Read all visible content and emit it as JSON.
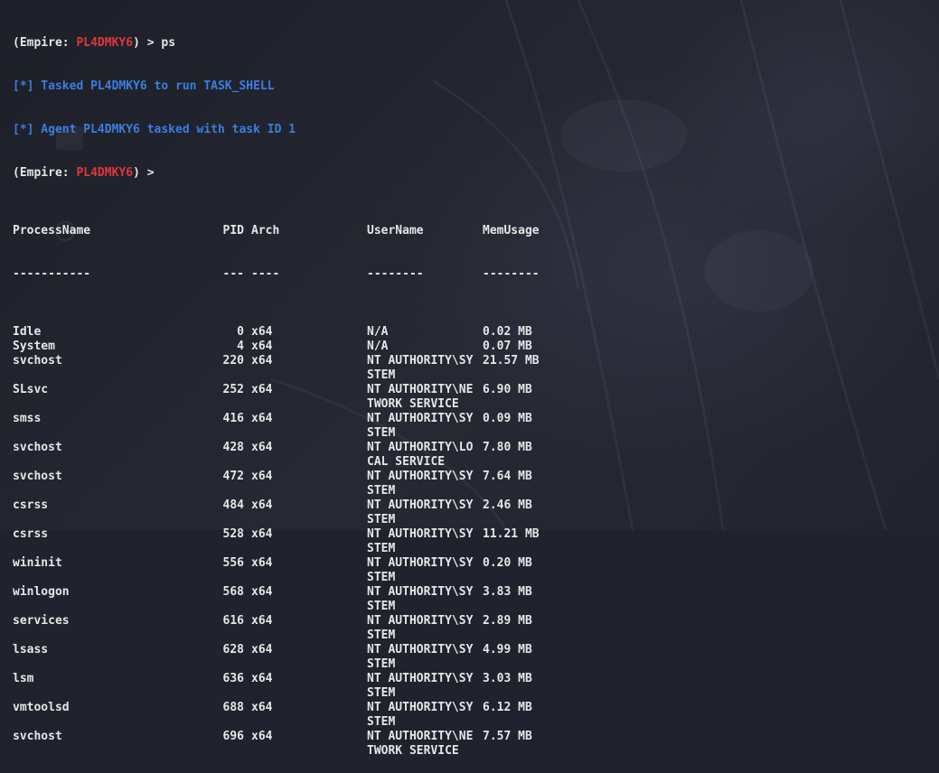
{
  "prompt": {
    "prefix": "(Empire: ",
    "agent": "PL4DMKY6",
    "suffix": ") > ",
    "command": "ps"
  },
  "messages": [
    "[*] Tasked PL4DMKY6 to run TASK_SHELL",
    "[*] Agent PL4DMKY6 tasked with task ID 1"
  ],
  "prompt2": {
    "prefix": "(Empire: ",
    "agent": "PL4DMKY6",
    "suffix": ") >"
  },
  "table": {
    "headers": [
      "ProcessName",
      "PID",
      "Arch",
      "UserName",
      "MemUsage"
    ],
    "separators": [
      "-----------",
      "---",
      "----",
      "--------",
      "--------"
    ],
    "rows": [
      {
        "name": "Idle",
        "pid": "0",
        "arch": "x64",
        "user": "N/A",
        "user2": "",
        "mem": "0.02 MB"
      },
      {
        "name": "System",
        "pid": "4",
        "arch": "x64",
        "user": "N/A",
        "user2": "",
        "mem": "0.07 MB"
      },
      {
        "name": "svchost",
        "pid": "220",
        "arch": "x64",
        "user": "NT AUTHORITY\\SY",
        "user2": "STEM",
        "mem": "21.57 MB"
      },
      {
        "name": "SLsvc",
        "pid": "252",
        "arch": "x64",
        "user": "NT AUTHORITY\\NE",
        "user2": "TWORK SERVICE",
        "mem": "6.90 MB"
      },
      {
        "name": "smss",
        "pid": "416",
        "arch": "x64",
        "user": "NT AUTHORITY\\SY",
        "user2": "STEM",
        "mem": "0.09 MB"
      },
      {
        "name": "svchost",
        "pid": "428",
        "arch": "x64",
        "user": "NT AUTHORITY\\LO",
        "user2": "CAL SERVICE",
        "mem": "7.80 MB"
      },
      {
        "name": "svchost",
        "pid": "472",
        "arch": "x64",
        "user": "NT AUTHORITY\\SY",
        "user2": "STEM",
        "mem": "7.64 MB"
      },
      {
        "name": "csrss",
        "pid": "484",
        "arch": "x64",
        "user": "NT AUTHORITY\\SY",
        "user2": "STEM",
        "mem": "2.46 MB"
      },
      {
        "name": "csrss",
        "pid": "528",
        "arch": "x64",
        "user": "NT AUTHORITY\\SY",
        "user2": "STEM",
        "mem": "11.21 MB"
      },
      {
        "name": "wininit",
        "pid": "556",
        "arch": "x64",
        "user": "NT AUTHORITY\\SY",
        "user2": "STEM",
        "mem": "0.20 MB"
      },
      {
        "name": "winlogon",
        "pid": "568",
        "arch": "x64",
        "user": "NT AUTHORITY\\SY",
        "user2": "STEM",
        "mem": "3.83 MB"
      },
      {
        "name": "services",
        "pid": "616",
        "arch": "x64",
        "user": "NT AUTHORITY\\SY",
        "user2": "STEM",
        "mem": "2.89 MB"
      },
      {
        "name": "lsass",
        "pid": "628",
        "arch": "x64",
        "user": "NT AUTHORITY\\SY",
        "user2": "STEM",
        "mem": "4.99 MB"
      },
      {
        "name": "lsm",
        "pid": "636",
        "arch": "x64",
        "user": "NT AUTHORITY\\SY",
        "user2": "STEM",
        "mem": "3.03 MB"
      },
      {
        "name": "vmtoolsd",
        "pid": "688",
        "arch": "x64",
        "user": "NT AUTHORITY\\SY",
        "user2": "STEM",
        "mem": "6.12 MB"
      },
      {
        "name": "svchost",
        "pid": "696",
        "arch": "x64",
        "user": "NT AUTHORITY\\NE",
        "user2": "TWORK SERVICE",
        "mem": "7.57 MB"
      }
    ]
  },
  "colors": {
    "agent": "#e0363b",
    "info": "#3a7ee0",
    "text": "#e6e6e6",
    "background": "#20232d"
  }
}
